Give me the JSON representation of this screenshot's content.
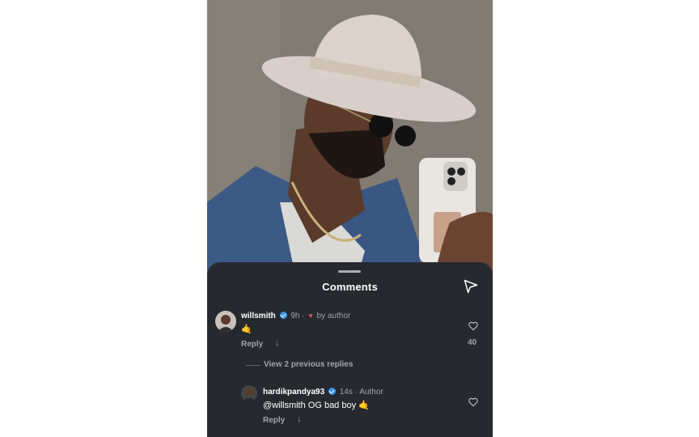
{
  "sheet": {
    "title": "Comments",
    "share_icon": "send-icon"
  },
  "comment1": {
    "username": "willsmith",
    "time": "9h",
    "separator": "·",
    "liked_by": "by author",
    "text": "🤙",
    "reply_label": "Reply",
    "like_count": "40"
  },
  "view_more": "View 2 previous replies",
  "reply1": {
    "username": "hardikpandya93",
    "time": "14s",
    "separator": "·",
    "author_tag": "Author",
    "text": "@willsmith OG bad boy 🤙",
    "reply_label": "Reply"
  },
  "colors": {
    "sheet_bg": "#26292e",
    "verified": "#3897f0",
    "heart": "#ed4956"
  }
}
